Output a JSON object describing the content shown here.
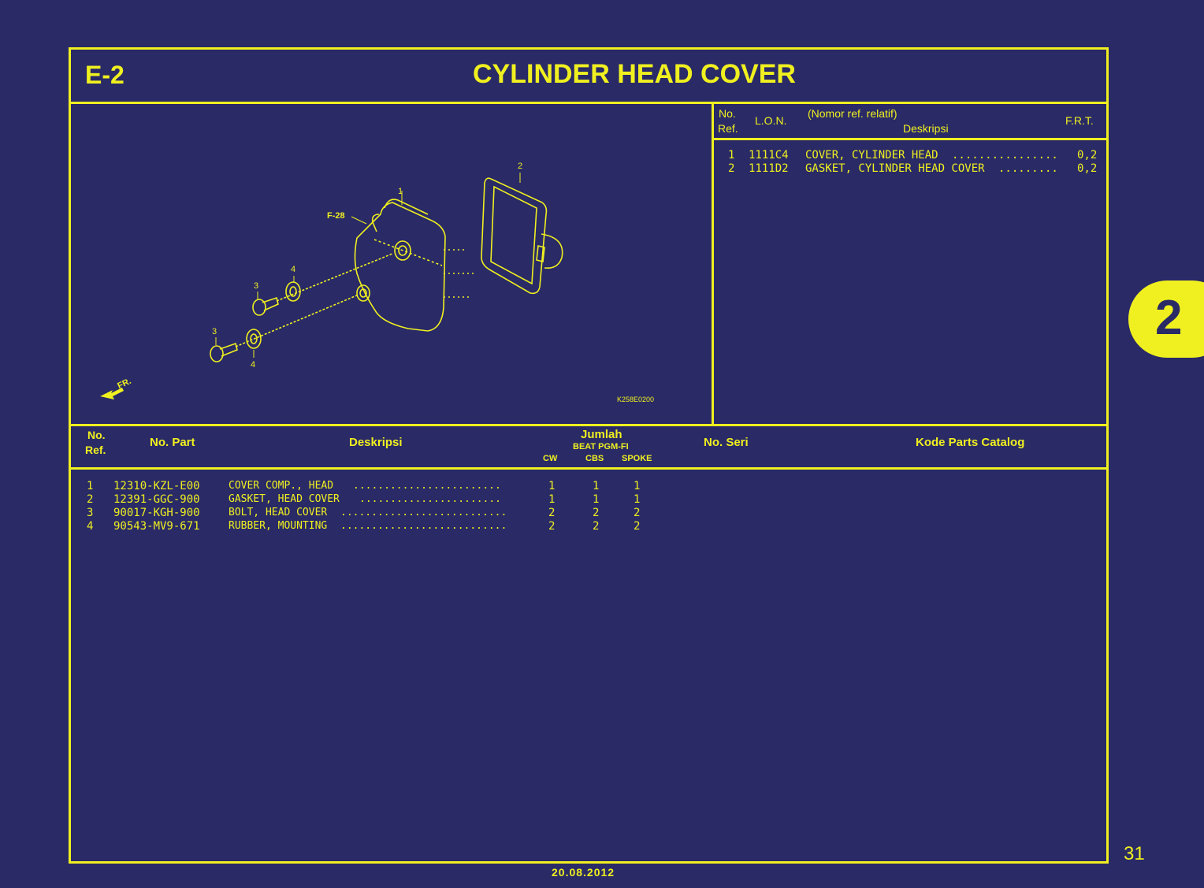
{
  "header": {
    "code": "E-2",
    "title": "CYLINDER HEAD COVER"
  },
  "diagram": {
    "callouts": [
      "1",
      "2",
      "3",
      "3",
      "4",
      "4"
    ],
    "ref_label": "F-28",
    "front_label": "FR.",
    "drawing_id": "K258E0200"
  },
  "lon_table": {
    "col_no": "No.",
    "col_ref": "Ref.",
    "col_lon": "L.O.N.",
    "col_nomor": "(Nomor ref. relatif)",
    "col_desc": "Deskripsi",
    "col_frt": "F.R.T.",
    "rows": [
      {
        "ref": "1",
        "lon": "1111C4",
        "desc": "COVER, CYLINDER HEAD",
        "dots": "................",
        "frt": "0,2"
      },
      {
        "ref": "2",
        "lon": "1111D2",
        "desc": "GASKET, CYLINDER HEAD COVER",
        "dots": ".........",
        "frt": "0,2"
      }
    ]
  },
  "parts_table": {
    "col_no": "No.",
    "col_ref": "Ref.",
    "col_part": "No. Part",
    "col_desc": "Deskripsi",
    "col_jumlah": "Jumlah",
    "col_model": "BEAT PGM-FI",
    "col_cw": "CW",
    "col_cbs": "CBS",
    "col_spoke": "SPOKE",
    "col_seri": "No. Seri",
    "col_catalog": "Kode Parts Catalog",
    "rows": [
      {
        "ref": "1",
        "part": "12310-KZL-E00",
        "desc": "COVER COMP., HEAD",
        "dots": "........................",
        "cw": "1",
        "cbs": "1",
        "spoke": "1"
      },
      {
        "ref": "2",
        "part": "12391-GGC-900",
        "desc": "GASKET, HEAD COVER",
        "dots": ".......................",
        "cw": "1",
        "cbs": "1",
        "spoke": "1"
      },
      {
        "ref": "3",
        "part": "90017-KGH-900",
        "desc": "BOLT, HEAD COVER",
        "dots": "...........................",
        "cw": "2",
        "cbs": "2",
        "spoke": "2"
      },
      {
        "ref": "4",
        "part": "90543-MV9-671",
        "desc": "RUBBER, MOUNTING",
        "dots": "...........................",
        "cw": "2",
        "cbs": "2",
        "spoke": "2"
      }
    ]
  },
  "side_tab": "2",
  "page_number": "31",
  "date": "20.08.2012",
  "colors": {
    "background": "#292a66",
    "accent": "#f0f020"
  }
}
